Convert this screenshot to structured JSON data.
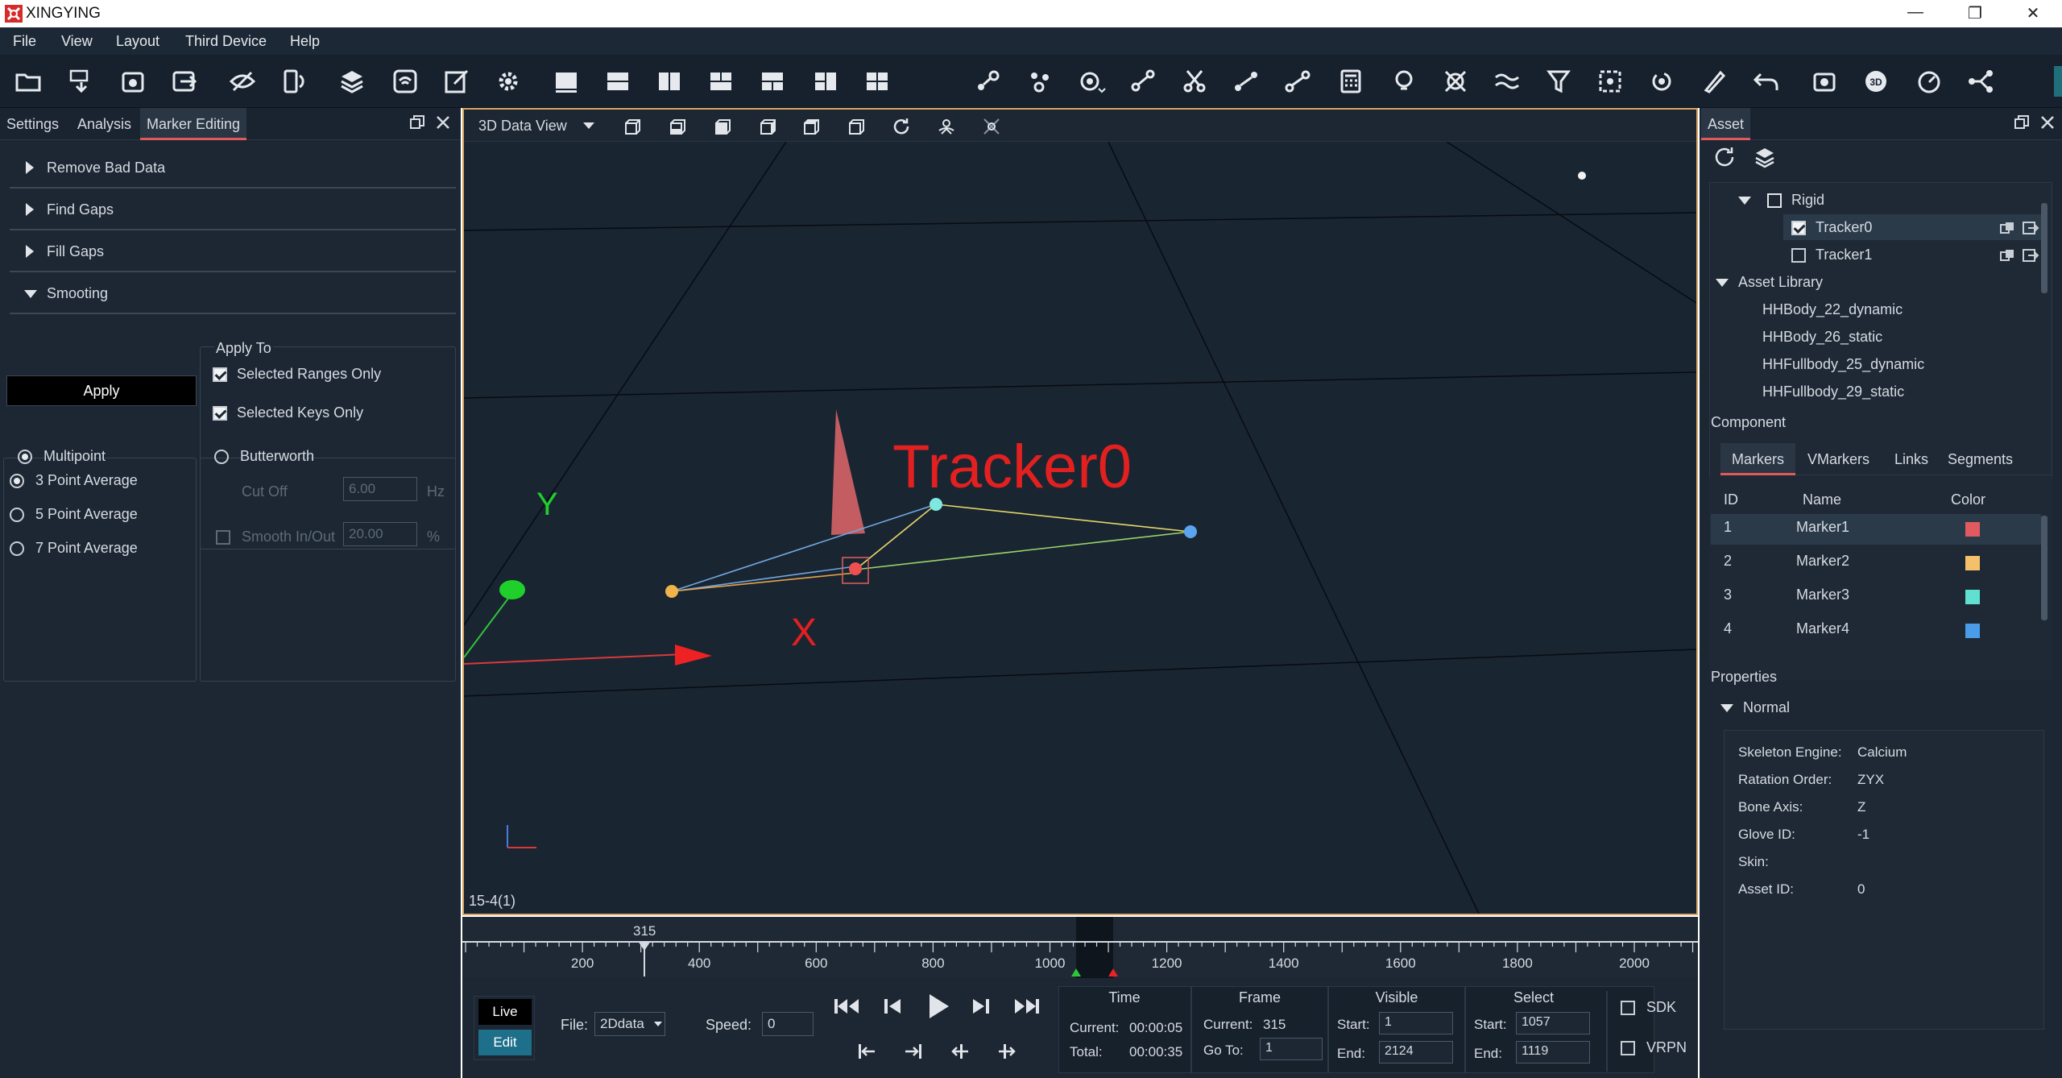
{
  "app": {
    "title": "XINGYING"
  },
  "window_controls": {
    "minimize": "—",
    "restore": "❐",
    "close": "✕"
  },
  "menu": [
    "File",
    "View",
    "Layout",
    "Third Device",
    "Help"
  ],
  "left_panel": {
    "tabs": [
      "Settings",
      "Analysis",
      "Marker Editing"
    ],
    "active_tab": "Marker Editing",
    "sections": [
      "Remove Bad Data",
      "Find Gaps",
      "Fill Gaps",
      "Smooting"
    ],
    "apply_button": "Apply",
    "apply_to": {
      "title": "Apply To",
      "selected_ranges": {
        "label": "Selected Ranges Only",
        "checked": true
      },
      "selected_keys": {
        "label": "Selected Keys Only",
        "checked": true
      }
    },
    "multipoint": {
      "label": "Multipoint",
      "options": [
        "3 Point Average",
        "5 Point Average",
        "7 Point Average"
      ],
      "selected": "3 Point Average"
    },
    "butterworth": {
      "label": "Butterworth",
      "cutoff_label": "Cut Off",
      "cutoff_value": "6.00",
      "cutoff_unit": "Hz",
      "smooth_label": "Smooth In/Out",
      "smooth_value": "20.00",
      "smooth_unit": "%"
    }
  },
  "viewport": {
    "dropdown": "3D Data View",
    "label_tracker": "Tracker0",
    "axis_y": "Y",
    "axis_x": "X",
    "status": "15-4(1)"
  },
  "right_panel": {
    "tab": "Asset",
    "tree": {
      "rigid": "Rigid",
      "trackers": [
        {
          "name": "Tracker0",
          "checked": true
        },
        {
          "name": "Tracker1",
          "checked": false
        }
      ],
      "library_label": "Asset Library",
      "library": [
        "HHBody_22_dynamic",
        "HHBody_26_static",
        "HHFullbody_25_dynamic",
        "HHFullbody_29_static"
      ]
    },
    "component_label": "Component",
    "component_tabs": [
      "Markers",
      "VMarkers",
      "Links",
      "Segments"
    ],
    "table_headers": [
      "ID",
      "Name",
      "Color"
    ],
    "markers": [
      {
        "id": "1",
        "name": "Marker1",
        "color": "#e05a5f"
      },
      {
        "id": "2",
        "name": "Marker2",
        "color": "#f4c16a"
      },
      {
        "id": "3",
        "name": "Marker3",
        "color": "#5fe0d0"
      },
      {
        "id": "4",
        "name": "Marker4",
        "color": "#4a9be8"
      }
    ],
    "properties_label": "Properties",
    "normal_label": "Normal",
    "properties": [
      {
        "k": "Skeleton Engine:",
        "v": "Calcium"
      },
      {
        "k": "Ratation Order:",
        "v": "ZYX"
      },
      {
        "k": "Bone Axis:",
        "v": "Z"
      },
      {
        "k": "Glove ID:",
        "v": "-1"
      },
      {
        "k": "Skin:",
        "v": ""
      },
      {
        "k": "Asset ID:",
        "v": "0"
      }
    ]
  },
  "timeline": {
    "ticks": [
      "200",
      "400",
      "600",
      "800",
      "1000",
      "1200",
      "1400",
      "1600",
      "1800",
      "2000"
    ],
    "current_marker": "315",
    "live_label": "Live",
    "edit_label": "Edit",
    "file_label": "File:",
    "file_value": "2Ddata",
    "speed_label": "Speed:",
    "speed_value": "0",
    "time": {
      "title": "Time",
      "current_label": "Current:",
      "current_value": "00:00:05",
      "total_label": "Total:",
      "total_value": "00:00:35"
    },
    "frame": {
      "title": "Frame",
      "current_label": "Current:",
      "current_value": "315",
      "goto_label": "Go To:",
      "goto_value": "1"
    },
    "visible": {
      "title": "Visible",
      "start_label": "Start:",
      "start_value": "1",
      "end_label": "End:",
      "end_value": "2124"
    },
    "select": {
      "title": "Select",
      "start_label": "Start:",
      "start_value": "1057",
      "end_label": "End:",
      "end_value": "1119"
    },
    "sdk_label": "SDK",
    "vrpn_label": "VRPN"
  }
}
